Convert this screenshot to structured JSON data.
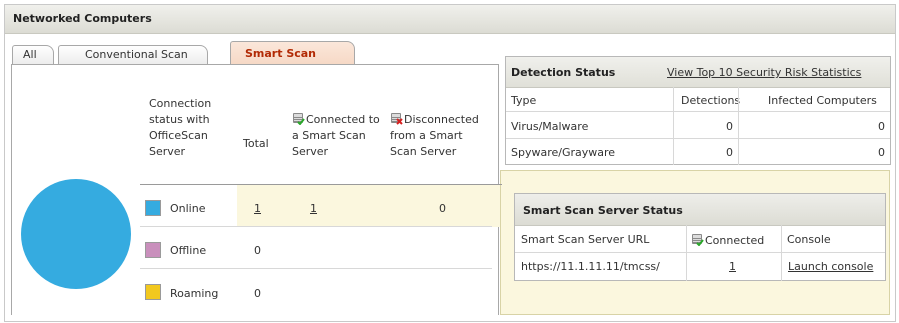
{
  "window": {
    "title": "Networked Computers"
  },
  "tabs": [
    {
      "label": "All"
    },
    {
      "label": "Conventional Scan"
    },
    {
      "label": "Smart Scan",
      "active": true
    }
  ],
  "connection_table": {
    "col_status": "Connection status with OfficeScan Server",
    "col_total": "Total",
    "col_connected": "Connected to a Smart Scan Server",
    "col_disconnected": "Disconnected from a Smart Scan Server",
    "rows": [
      {
        "label": "Online",
        "color": "#35abe0",
        "total": "1",
        "connected": "1",
        "disconnected": "0"
      },
      {
        "label": "Offline",
        "color": "#c98fbc",
        "total": "0"
      },
      {
        "label": "Roaming",
        "color": "#f2c81e",
        "total": "0"
      }
    ]
  },
  "pie_color": "#35abe0",
  "detection_status": {
    "title": "Detection Status",
    "link": "View Top 10 Security Risk Statistics",
    "columns": [
      "Type",
      "Detections",
      "Infected Computers"
    ],
    "rows": [
      {
        "type": "Virus/Malware",
        "detections": "0",
        "infected": "0"
      },
      {
        "type": "Spyware/Grayware",
        "detections": "0",
        "infected": "0"
      }
    ]
  },
  "smart_scan_server_status": {
    "title": "Smart Scan Server Status",
    "columns": [
      "Smart Scan Server URL",
      "Connected",
      "Console"
    ],
    "rows": [
      {
        "url": "https://11.1.11.11/tmcss/",
        "connected": "1",
        "console": "Launch console"
      }
    ]
  },
  "icons": {
    "connected": "computer-connected-icon",
    "disconnected": "computer-disconnected-icon"
  }
}
